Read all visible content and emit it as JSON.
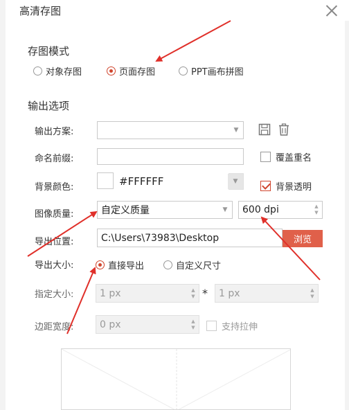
{
  "dialog": {
    "title": "高清存图"
  },
  "save_mode": {
    "heading": "存图模式",
    "options": [
      {
        "label": "对象存图",
        "selected": false
      },
      {
        "label": "页面存图",
        "selected": true
      },
      {
        "label": "PPT画布拼图",
        "selected": false
      }
    ]
  },
  "output": {
    "heading": "输出选项",
    "scheme": {
      "label": "输出方案:",
      "value": ""
    },
    "prefix": {
      "label": "命名前缀:",
      "value": "",
      "overwrite_label": "覆盖重名",
      "overwrite_checked": false
    },
    "bg": {
      "label": "背景颜色:",
      "hex": "#FFFFFF",
      "transparent_label": "背景透明",
      "transparent_checked": true
    },
    "quality": {
      "label": "图像质量:",
      "value": "自定义质量",
      "dpi": "600 dpi"
    },
    "location": {
      "label": "导出位置:",
      "path": "C:\\Users\\73983\\Desktop",
      "browse_label": "浏览"
    },
    "size": {
      "label": "导出大小:",
      "options": [
        {
          "label": "直接导出",
          "selected": true
        },
        {
          "label": "自定义尺寸",
          "selected": false
        }
      ]
    },
    "specified": {
      "label": "指定大小:",
      "width": "1 px",
      "times": "*",
      "height": "1 px"
    },
    "margin": {
      "label": "边距宽度:",
      "value": "0 px",
      "stretch_label": "支持拉伸",
      "stretch_checked": false
    }
  },
  "colors": {
    "accent": "#d0462e",
    "arrow": "#e0302a",
    "browse_bg": "#e0604a"
  },
  "icons": [
    "close-icon",
    "save-icon",
    "trash-icon",
    "chevron-down-icon"
  ]
}
